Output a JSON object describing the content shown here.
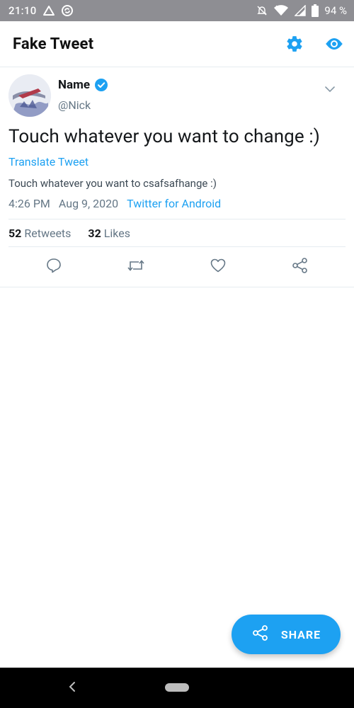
{
  "status_bar": {
    "time": "21:10",
    "battery": "94 %",
    "icons": [
      "triangle-icon",
      "circle-sync-icon",
      "mute-bell-icon",
      "wifi-icon",
      "signal-icon",
      "battery-icon"
    ]
  },
  "app_bar": {
    "title": "Fake Tweet",
    "actions": [
      "settings-icon",
      "eye-icon"
    ]
  },
  "tweet": {
    "name": "Name",
    "handle": "@Nick",
    "text": "Touch whatever you want to change :)",
    "translate_label": "Translate Tweet",
    "translated_text": "Touch whatever you want to csafsafhange :)",
    "time": "4:26 PM",
    "date": "Aug 9, 2020",
    "source": "Twitter for Android",
    "retweets_count": "52",
    "retweets_label": "Retweets",
    "likes_count": "32",
    "likes_label": "Likes"
  },
  "fab": {
    "label": "SHARE"
  },
  "colors": {
    "accent": "#1da1f2",
    "status_bar": "#8e8e93",
    "text_primary": "#14171a",
    "text_secondary": "#657786"
  }
}
